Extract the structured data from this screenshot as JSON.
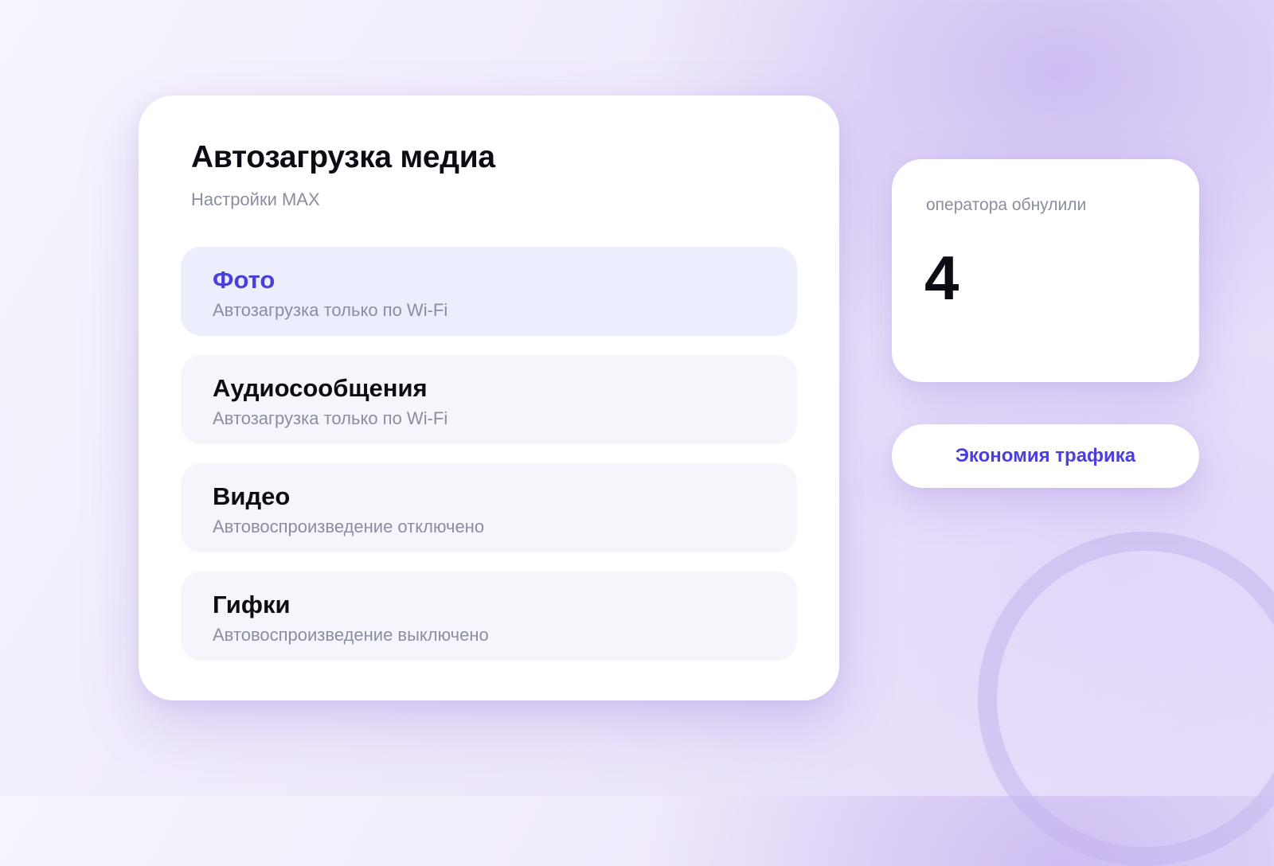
{
  "settings_card": {
    "title": "Автозагрузка медиа",
    "subtitle": "Настройки MAX",
    "items": [
      {
        "title": "Фото",
        "description": "Автозагрузка только по Wi-Fi",
        "selected": true
      },
      {
        "title": "Аудиосообщения",
        "description": "Автозагрузка только по Wi-Fi",
        "selected": false
      },
      {
        "title": "Видео",
        "description": "Автовоспроизведение отключено",
        "selected": false
      },
      {
        "title": "Гифки",
        "description": "Автовоспроизведение выключено",
        "selected": false
      }
    ]
  },
  "stat_card": {
    "label": "оператора обнулили",
    "value": "4"
  },
  "action": {
    "label": "Экономия трафика"
  },
  "colors": {
    "accent": "#4b3fdc",
    "selected_background": "#eceefe",
    "item_background": "#f6f5fb",
    "muted_text": "#8a8ea0",
    "primary_text": "#0c0c14"
  }
}
